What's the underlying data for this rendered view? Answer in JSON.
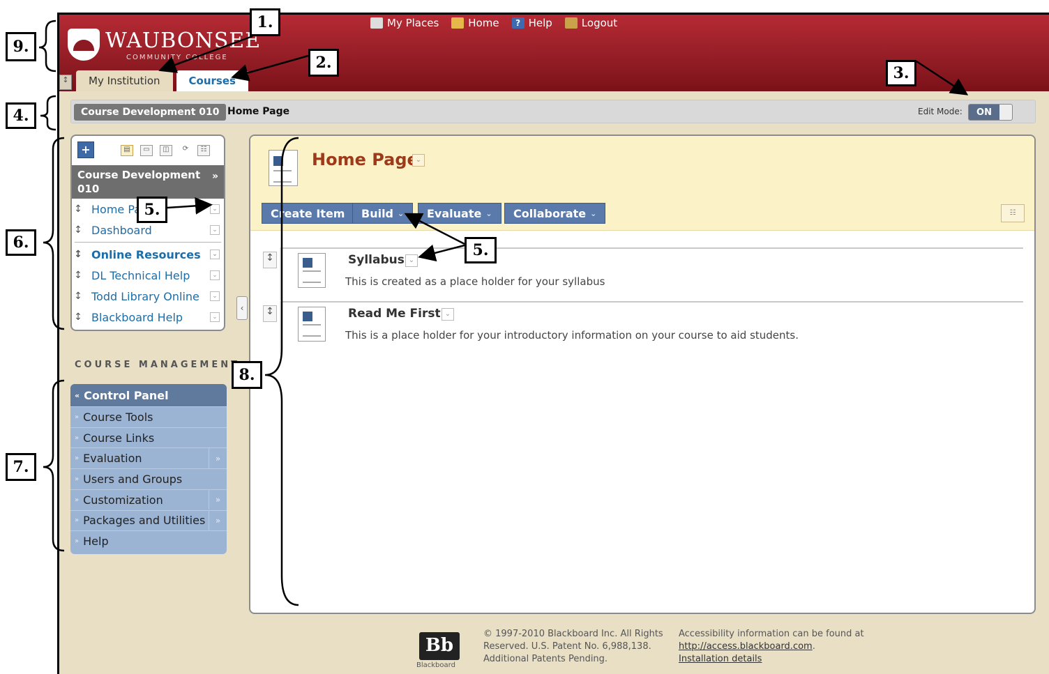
{
  "header": {
    "logo_name": "WAUBONSEE",
    "logo_sub": "COMMUNITY COLLEGE",
    "topnav": [
      {
        "label": "My Places",
        "icon": "person-icon"
      },
      {
        "label": "Home",
        "icon": "house-icon"
      },
      {
        "label": "Help",
        "icon": "question-icon"
      },
      {
        "label": "Logout",
        "icon": "door-icon"
      }
    ],
    "tabs": [
      {
        "label": "My Institution"
      },
      {
        "label": "Courses"
      }
    ]
  },
  "breadcrumb": {
    "course": "Course Development 010",
    "page": "Home Page",
    "edit_mode_label": "Edit Mode:",
    "edit_mode_value": "ON"
  },
  "course_menu": {
    "course_title": "Course Development 010",
    "items": [
      {
        "label": "Home Page"
      },
      {
        "label": "Dashboard"
      },
      {
        "label": "Online Resources"
      },
      {
        "label": "DL Technical Help"
      },
      {
        "label": "Todd Library Online"
      },
      {
        "label": "Blackboard Help"
      }
    ]
  },
  "course_management": {
    "title": "COURSE MANAGEMENT",
    "panel_title": "Control Panel",
    "items": [
      {
        "label": "Course Tools",
        "has_more": false
      },
      {
        "label": "Course Links",
        "has_more": false
      },
      {
        "label": "Evaluation",
        "has_more": true
      },
      {
        "label": "Users and Groups",
        "has_more": false
      },
      {
        "label": "Customization",
        "has_more": true
      },
      {
        "label": "Packages and Utilities",
        "has_more": true
      },
      {
        "label": "Help",
        "has_more": false
      }
    ]
  },
  "content": {
    "title": "Home Page",
    "actions": [
      {
        "label": "Create Item",
        "chevron": false
      },
      {
        "label": "Build",
        "chevron": true
      },
      {
        "label": "Evaluate",
        "chevron": true
      },
      {
        "label": "Collaborate",
        "chevron": true
      }
    ],
    "items": [
      {
        "title": "Syllabus",
        "description": "This is created as a place holder for your syllabus"
      },
      {
        "title": "Read Me First",
        "description": "This is a place holder for your introductory information on your course to aid students."
      }
    ]
  },
  "footer": {
    "bb_logo": "Bb",
    "bb_name": "Blackboard",
    "copyright": "© 1997-2010 Blackboard Inc. All Rights Reserved. U.S. Patent No. 6,988,138. Additional Patents Pending.",
    "access_text": "Accessibility information can be found at",
    "access_link": "http://access.blackboard.com",
    "install_link": "Installation details"
  },
  "annotations": [
    "1.",
    "2.",
    "3.",
    "4.",
    "5.",
    "5.",
    "6.",
    "7.",
    "8.",
    "9.",
    "5."
  ],
  "colors": {
    "header_red": "#8c1a22",
    "action_blue": "#5a7aac",
    "title_brown": "#9d3a1a",
    "link_blue": "#1d6da9"
  }
}
